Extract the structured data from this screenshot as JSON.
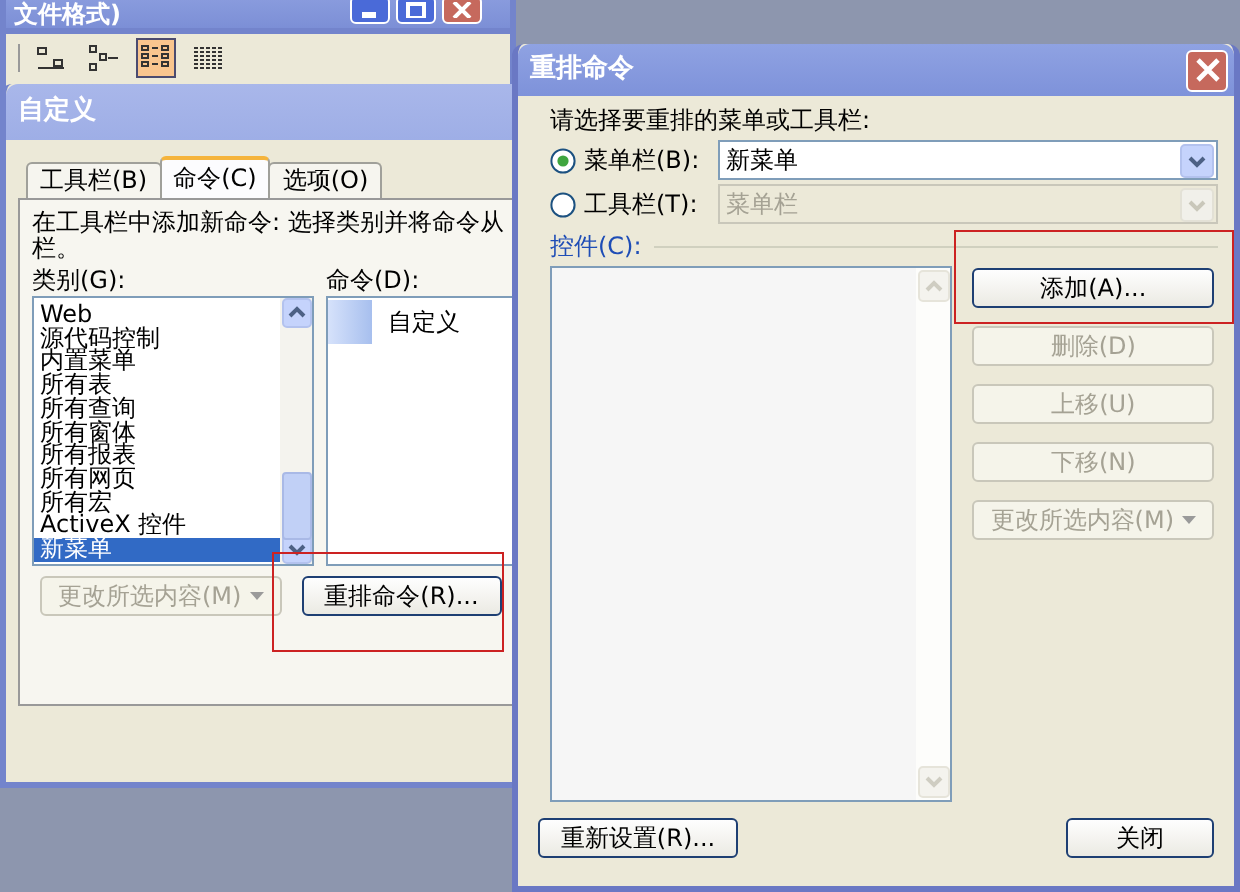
{
  "background_window": {
    "title": "文件格式)",
    "toolbar_buttons": [
      {
        "selected": false
      },
      {
        "selected": false
      },
      {
        "selected": true
      },
      {
        "selected": false
      }
    ]
  },
  "customize_dialog": {
    "title": "自定义",
    "tabs": [
      {
        "label": "工具栏(B)",
        "selected": false
      },
      {
        "label": "命令(C)",
        "selected": true
      },
      {
        "label": "选项(O)",
        "selected": false
      }
    ],
    "instructions": [
      "在工具栏中添加新命令: 选择类别并将命令从",
      "栏。"
    ],
    "categories_label": "类别(G):",
    "categories": [
      {
        "label": "Web",
        "selected": false
      },
      {
        "label": "源代码控制",
        "selected": false
      },
      {
        "label": "内置菜单",
        "selected": false
      },
      {
        "label": "所有表",
        "selected": false
      },
      {
        "label": "所有查询",
        "selected": false
      },
      {
        "label": "所有窗体",
        "selected": false
      },
      {
        "label": "所有报表",
        "selected": false
      },
      {
        "label": "所有网页",
        "selected": false
      },
      {
        "label": "所有宏",
        "selected": false
      },
      {
        "label": "ActiveX 控件",
        "selected": false
      },
      {
        "label": "新菜单",
        "selected": true
      }
    ],
    "commands_label": "命令(D):",
    "commands": [
      {
        "label": "自定义"
      }
    ],
    "buttons": [
      {
        "label": "更改所选内容(M)",
        "kind": "dropdown",
        "disabled": true
      },
      {
        "label": "重排命令(R)...",
        "kind": "push",
        "disabled": false
      }
    ]
  },
  "rearrange_dialog": {
    "title": "重排命令",
    "prompt": "请选择要重排的菜单或工具栏:",
    "options": [
      {
        "label": "菜单栏(B):",
        "selected": true,
        "value": "新菜单",
        "disabled": false
      },
      {
        "label": "工具栏(T):",
        "selected": false,
        "value": "菜单栏",
        "disabled": true
      }
    ],
    "controls_label": "控件(C):",
    "buttons": [
      {
        "label": "添加(A)...",
        "kind": "push",
        "disabled": false
      },
      {
        "label": "删除(D)",
        "kind": "push",
        "disabled": true
      },
      {
        "label": "上移(U)",
        "kind": "push",
        "disabled": true
      },
      {
        "label": "下移(N)",
        "kind": "push",
        "disabled": true
      },
      {
        "label": "更改所选内容(M)",
        "kind": "dropdown",
        "disabled": true
      }
    ],
    "reset_button": "重新设置(R)...",
    "close_button": "关闭"
  }
}
